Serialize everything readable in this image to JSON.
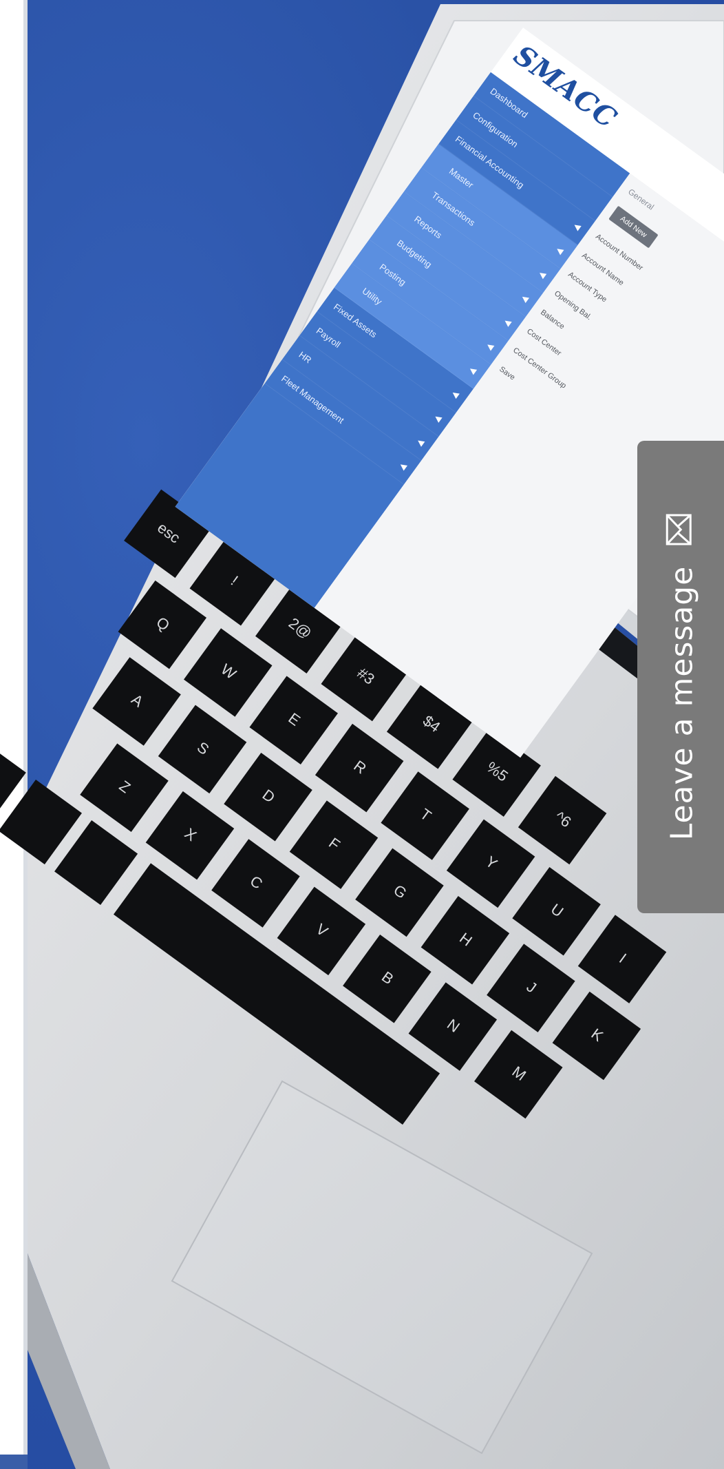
{
  "screen": {
    "logo": "SMACC",
    "sidebar_items": [
      {
        "label": "Dashboard",
        "sub": false
      },
      {
        "label": "Configuration",
        "sub": false
      },
      {
        "label": "Financial Accounting",
        "sub": false
      },
      {
        "label": "Master",
        "sub": true
      },
      {
        "label": "Transactions",
        "sub": true
      },
      {
        "label": "Reports",
        "sub": true
      },
      {
        "label": "Budgeting",
        "sub": true
      },
      {
        "label": "Posting",
        "sub": true
      },
      {
        "label": "Utility",
        "sub": true
      },
      {
        "label": "Fixed Assets",
        "sub": false
      },
      {
        "label": "Payroll",
        "sub": false
      },
      {
        "label": "HR",
        "sub": false
      },
      {
        "label": "Fleet Management",
        "sub": false
      }
    ],
    "crumb": "General",
    "add_button": "Add New",
    "rows": [
      "Account Number",
      "Account Name",
      "Account Type",
      "Opening Bal.",
      "Balance",
      "Cost Center",
      "Cost Center Group",
      "Save"
    ]
  },
  "keyboard": {
    "row_num": [
      "esc",
      "!",
      "2@",
      "#3",
      "$4",
      "%5",
      "^6"
    ],
    "row_q": [
      "Q",
      "W",
      "E",
      "R",
      "T",
      "Y",
      "U",
      "I"
    ],
    "row_a": [
      "A",
      "S",
      "D",
      "F",
      "G",
      "H",
      "J",
      "K"
    ],
    "row_z": [
      "Z",
      "X",
      "C",
      "V",
      "B",
      "N",
      "M"
    ]
  },
  "message_tab": {
    "label": "Leave a message",
    "icon": "envelope-icon"
  },
  "colors": {
    "background": "#2b54a8",
    "tab": "#7a7a7a",
    "sidebar": "#3f74c9"
  }
}
